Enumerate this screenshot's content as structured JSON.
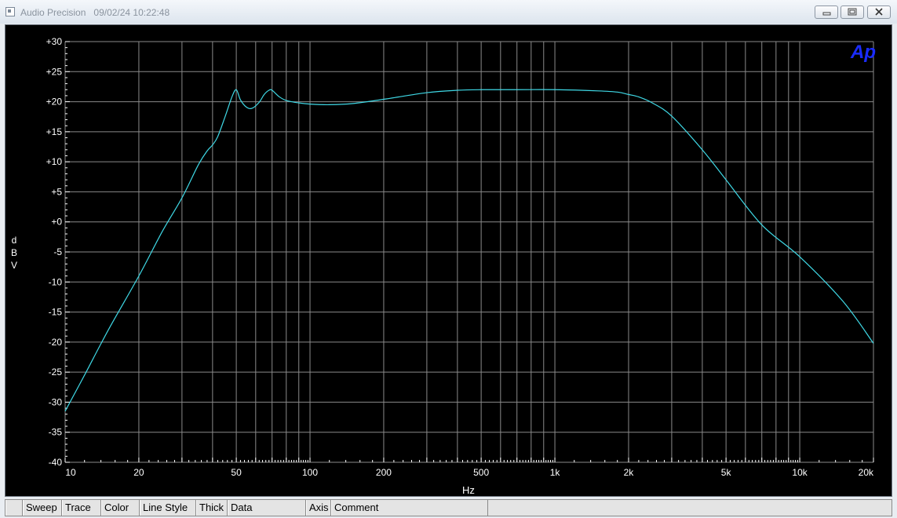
{
  "window": {
    "app_name": "Audio Precision",
    "timestamp": "09/02/24 10:22:48"
  },
  "logo": {
    "text": "Ap",
    "color": "#1a2cff"
  },
  "tabs": [
    "Sweep",
    "Trace",
    "Color",
    "Line Style",
    "Thick",
    "Data",
    "Axis",
    "Comment"
  ],
  "colors": {
    "background": "#000000",
    "grid": "#8a8a8a",
    "trace": "#3fd9e6",
    "tick_text": "#ffffff"
  },
  "chart_data": {
    "type": "line",
    "xscale": "log",
    "xlim": [
      10,
      20000
    ],
    "ylim": [
      -40,
      30
    ],
    "xlabel": "Hz",
    "ylabel": "dBV",
    "grid": true,
    "x_tick_labels": [
      {
        "value": 10,
        "label": "10"
      },
      {
        "value": 20,
        "label": "20"
      },
      {
        "value": 50,
        "label": "50"
      },
      {
        "value": 100,
        "label": "100"
      },
      {
        "value": 200,
        "label": "200"
      },
      {
        "value": 500,
        "label": "500"
      },
      {
        "value": 1000,
        "label": "1k"
      },
      {
        "value": 2000,
        "label": "2k"
      },
      {
        "value": 5000,
        "label": "5k"
      },
      {
        "value": 10000,
        "label": "10k"
      },
      {
        "value": 20000,
        "label": "20k"
      }
    ],
    "y_tick_labels": [
      {
        "value": 30,
        "label": "+30"
      },
      {
        "value": 25,
        "label": "+25"
      },
      {
        "value": 20,
        "label": "+20"
      },
      {
        "value": 15,
        "label": "+15"
      },
      {
        "value": 10,
        "label": "+10"
      },
      {
        "value": 5,
        "label": "+5"
      },
      {
        "value": 0,
        "label": "+0"
      },
      {
        "value": -5,
        "label": "-5"
      },
      {
        "value": -10,
        "label": "-10"
      },
      {
        "value": -15,
        "label": "-15"
      },
      {
        "value": -20,
        "label": "-20"
      },
      {
        "value": -25,
        "label": "-25"
      },
      {
        "value": -30,
        "label": "-30"
      },
      {
        "value": -35,
        "label": "-35"
      },
      {
        "value": -40,
        "label": "-40"
      }
    ],
    "series": [
      {
        "x": [
          10,
          12,
          15,
          20,
          25,
          30,
          35,
          38,
          40,
          42,
          45,
          48,
          50,
          52,
          55,
          58,
          62,
          65,
          68,
          70,
          75,
          80,
          90,
          100,
          120,
          150,
          200,
          300,
          400,
          500,
          700,
          1000,
          1500,
          1800,
          2000,
          2200,
          2500,
          3000,
          4000,
          5000,
          7000,
          10000,
          15000,
          20000
        ],
        "y": [
          -31.5,
          -25.5,
          -18,
          -9,
          -1.5,
          4,
          9.5,
          11.8,
          12.8,
          14.2,
          17.5,
          20.8,
          22.0,
          20.3,
          19.1,
          18.9,
          19.9,
          21.2,
          21.9,
          21.9,
          20.8,
          20.2,
          19.8,
          19.6,
          19.5,
          19.7,
          20.4,
          21.5,
          21.9,
          22.0,
          22.0,
          22.0,
          21.8,
          21.6,
          21.2,
          20.8,
          19.8,
          17.6,
          12.0,
          7.0,
          -0.5,
          -5.8,
          -13.2,
          -20.2
        ]
      }
    ]
  }
}
